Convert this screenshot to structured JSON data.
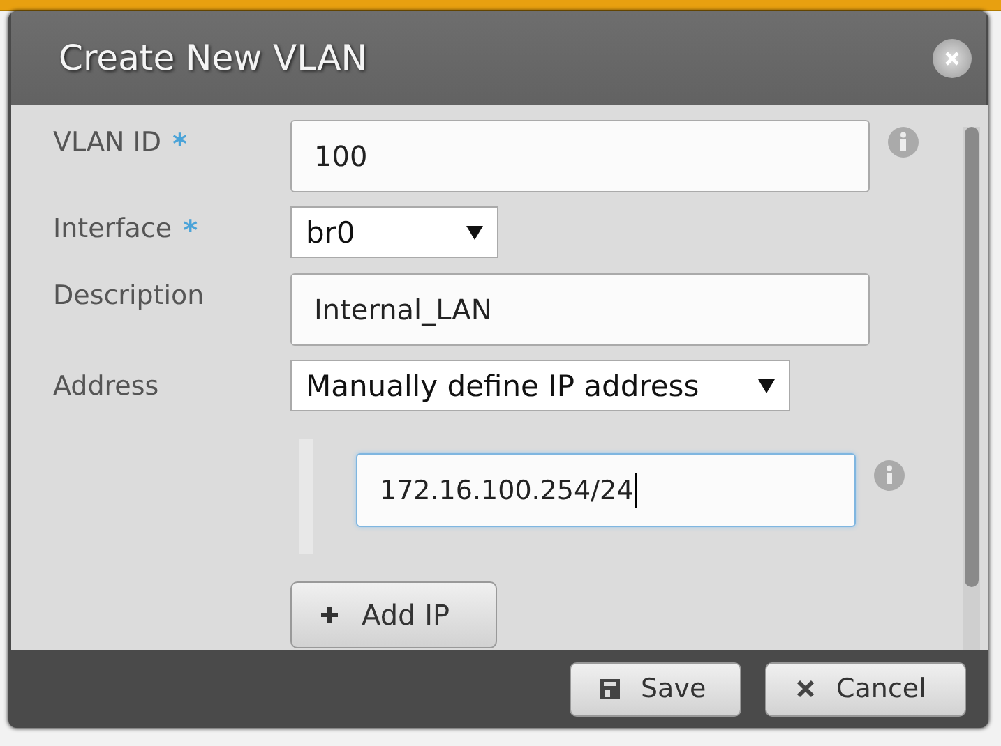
{
  "dialog": {
    "title": "Create New VLAN",
    "fields": [
      {
        "kind": "input",
        "label": "VLAN ID",
        "required_mark": "*",
        "value": "100",
        "info": true
      },
      {
        "kind": "select",
        "label": "Interface",
        "required_mark": "*",
        "value": "br0",
        "info": false
      },
      {
        "kind": "input",
        "label": "Description",
        "value": "Internal_LAN",
        "info": false
      },
      {
        "kind": "select",
        "label": "Address",
        "value": "Manually define IP address",
        "info": false
      }
    ],
    "addresses": [
      {
        "value": "172.16.100.254/24",
        "focused": true,
        "info": true
      }
    ],
    "add_button": "Add IP",
    "buttons": [
      {
        "kind": "save",
        "label": "Save"
      },
      {
        "kind": "cancel",
        "label": "Cancel"
      }
    ]
  }
}
